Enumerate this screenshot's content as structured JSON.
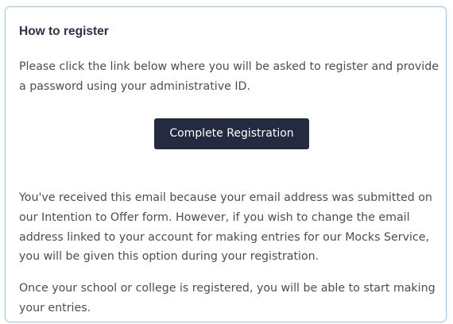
{
  "card": {
    "title": "How to register",
    "intro": "Please click the link below where you will be asked to register and provide a password using your administrative ID.",
    "button_label": "Complete Registration",
    "email_notice": "You've received this email because your email address was submitted on our Intention to Offer form. However, if you wish to change the email address linked to your account for making entries for our Mocks Service, you will be given this option during your registration.",
    "closing": "Once your school or college is registered, you will be able to start making your entries."
  },
  "colors": {
    "border": "#a9c6df",
    "button_bg": "#242a40",
    "title_text": "#2b3347",
    "body_text": "#4a4d57"
  }
}
